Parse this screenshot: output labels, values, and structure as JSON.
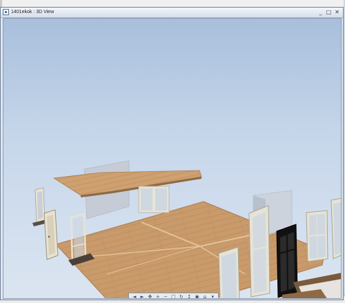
{
  "window": {
    "title": "1401ekok : 3D View"
  },
  "controls": {
    "minimize": "_",
    "maximize": "□",
    "close": "✕"
  },
  "navbar": {
    "buttons": [
      {
        "icon": "orbit-left-icon",
        "glyph": "◄"
      },
      {
        "icon": "orbit-right-icon",
        "glyph": "►"
      },
      {
        "icon": "pan-icon",
        "glyph": "✥"
      },
      {
        "icon": "zoom-in-icon",
        "glyph": "+"
      },
      {
        "icon": "zoom-out-icon",
        "glyph": "−"
      },
      {
        "icon": "fit-icon",
        "glyph": "□"
      },
      {
        "icon": "rotate-icon",
        "glyph": "↻"
      },
      {
        "icon": "walk-icon",
        "glyph": "↥"
      },
      {
        "icon": "look-icon",
        "glyph": "◉"
      },
      {
        "icon": "home-view-icon",
        "glyph": "⌂"
      },
      {
        "icon": "settings-icon",
        "glyph": "▾"
      }
    ]
  },
  "colors": {
    "floor": "#c99a6a",
    "floor_edge": "#a97b4e",
    "wall": "#c5ccd6",
    "door_frame": "#e6e3d6",
    "dark_door": "#111111",
    "sky_top": "#a8bfdc"
  }
}
